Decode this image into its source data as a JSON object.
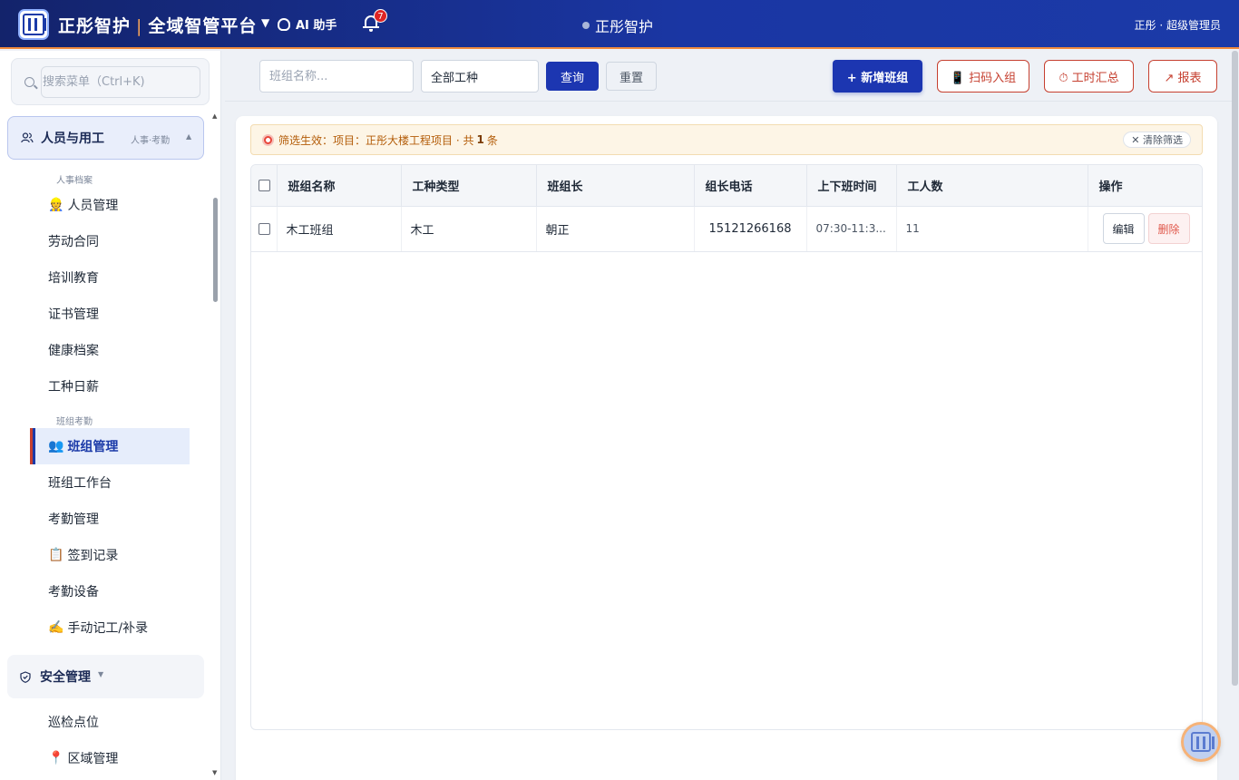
{
  "header": {
    "brand": "正彤智护",
    "platform": "全域智管平台",
    "ai_label": "AI 助手",
    "notification_count": "7",
    "center_title": "正彤智护",
    "user": "正彤 · 超级管理员"
  },
  "sidebar": {
    "search_placeholder": "搜索菜单（Ctrl+K)",
    "group_people": {
      "title": "人员与用工",
      "sub": "人事·考勤",
      "caret": "▲"
    },
    "section_archive": "人事档案",
    "archive_items": [
      {
        "icon": "👷",
        "label": "人员管理"
      },
      {
        "icon": "",
        "label": "劳动合同"
      },
      {
        "icon": "",
        "label": "培训教育"
      },
      {
        "icon": "",
        "label": "证书管理"
      },
      {
        "icon": "",
        "label": "健康档案"
      },
      {
        "icon": "",
        "label": "工种日薪"
      }
    ],
    "section_attendance": "班组考勤",
    "attendance_items": [
      {
        "icon": "👥",
        "label": "班组管理",
        "active": true
      },
      {
        "icon": "",
        "label": "班组工作台"
      },
      {
        "icon": "",
        "label": "考勤管理"
      },
      {
        "icon": "📋",
        "label": "签到记录"
      },
      {
        "icon": "",
        "label": "考勤设备"
      },
      {
        "icon": "✍️",
        "label": "手动记工/补录"
      }
    ],
    "group_safety": {
      "title": "安全管理",
      "caret": "▼"
    },
    "safety_items": [
      {
        "icon": "",
        "label": "巡检点位"
      },
      {
        "icon": "📍",
        "label": "区域管理"
      }
    ]
  },
  "toolbar": {
    "name_placeholder": "班组名称...",
    "trade_select": "全部工种",
    "query": "查询",
    "reset": "重置",
    "add": "+ 新增班组",
    "scan": "📱 扫码入组",
    "hours": "⏱ 工时汇总",
    "report": "↗ 报表"
  },
  "filter": {
    "prefix": "筛选生效：项目：正彤大楼工程项目 · 共",
    "count": "1",
    "suffix": "条",
    "clear": "✕ 清除筛选"
  },
  "table": {
    "columns": [
      "班组名称",
      "工种类型",
      "班组长",
      "组长电话",
      "上下班时间",
      "工人数",
      "操作"
    ],
    "rows": [
      {
        "name": "木工班组",
        "trade": "木工",
        "leader": "朝正",
        "phone": "15121266168",
        "time": "07:30-11:3...",
        "workers": "11"
      }
    ],
    "edit": "编辑",
    "delete": "删除"
  },
  "colors": {
    "primary": "#1c36b1",
    "accent": "#c64030",
    "header_start": "#13236b"
  }
}
